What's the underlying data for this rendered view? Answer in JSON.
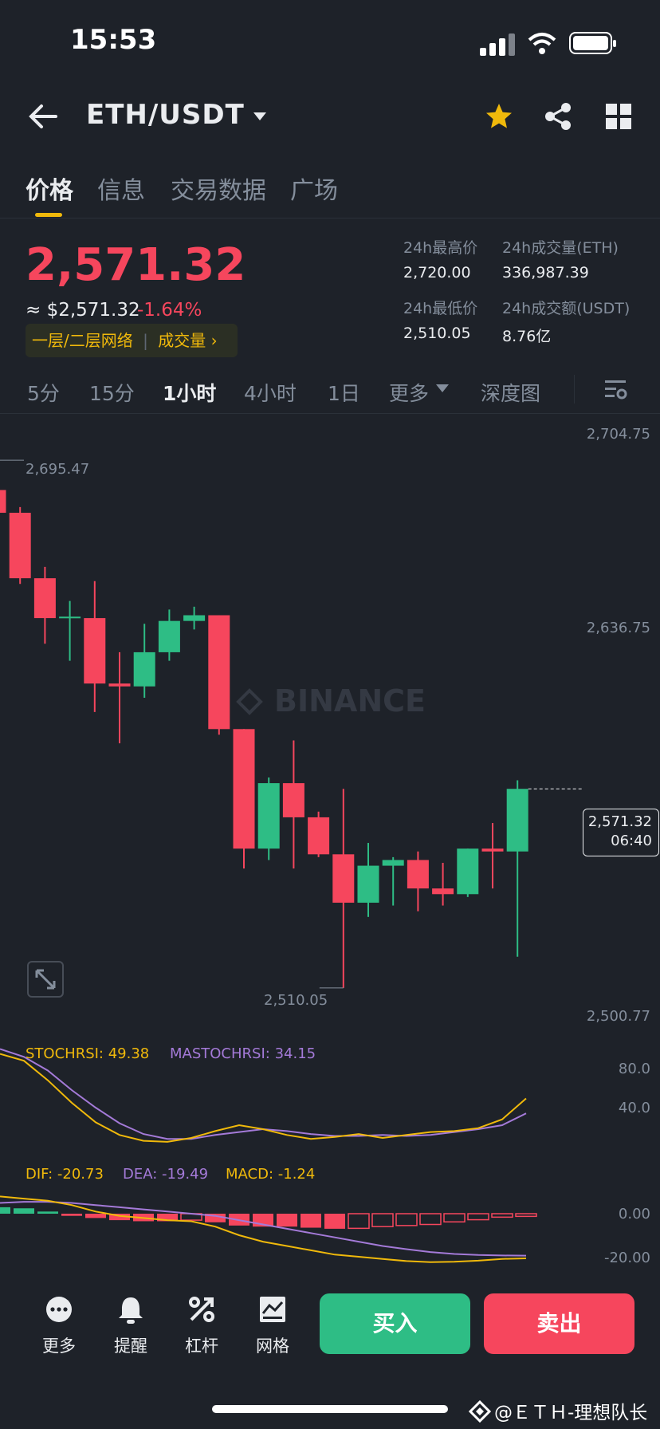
{
  "status_bar": {
    "time": "15:53"
  },
  "nav": {
    "pair": "ETH/USDT"
  },
  "tabs": [
    "价格",
    "信息",
    "交易数据",
    "广场"
  ],
  "price": {
    "last": "2,571.32",
    "usd": "≈ $2,571.32",
    "change": "-1.64%",
    "tag_network": "一层/二层网络",
    "tag_volume": "成交量 ›"
  },
  "stats": {
    "high_label": "24h最高价",
    "high_value": "2,720.00",
    "vol_label": "24h成交量(ETH)",
    "vol_value": "336,987.39",
    "low_label": "24h最低价",
    "low_value": "2,510.05",
    "amt_label": "24h成交额(USDT)",
    "amt_value": "8.76亿"
  },
  "timeframes": [
    "5分",
    "15分",
    "1小时",
    "4小时",
    "1日",
    "更多",
    "深度图"
  ],
  "timeframe_active": "1小时",
  "chart_data": {
    "type": "candlestick",
    "y_ticks": [
      "2,704.75",
      "2,636.75",
      "2,500.77"
    ],
    "high_marker": "2,695.47",
    "low_marker": "2,510.05",
    "last_price_tag": "2,571.32",
    "last_price_time": "06:40",
    "watermark": "BINANCE",
    "candles": [
      {
        "o": 2685,
        "h": 2695.47,
        "l": 2676,
        "c": 2677
      },
      {
        "o": 2677,
        "h": 2679,
        "l": 2652,
        "c": 2654
      },
      {
        "o": 2654,
        "h": 2658,
        "l": 2631,
        "c": 2640
      },
      {
        "o": 2640,
        "h": 2646,
        "l": 2625,
        "c": 2640.5
      },
      {
        "o": 2640,
        "h": 2653,
        "l": 2607,
        "c": 2617
      },
      {
        "o": 2617,
        "h": 2628,
        "l": 2596,
        "c": 2616
      },
      {
        "o": 2616,
        "h": 2638,
        "l": 2612,
        "c": 2628
      },
      {
        "o": 2628,
        "h": 2643,
        "l": 2625,
        "c": 2639
      },
      {
        "o": 2639,
        "h": 2644,
        "l": 2636,
        "c": 2641
      },
      {
        "o": 2641,
        "h": 2641,
        "l": 2599,
        "c": 2601
      },
      {
        "o": 2601,
        "h": 2601,
        "l": 2552,
        "c": 2559
      },
      {
        "o": 2559,
        "h": 2584,
        "l": 2555,
        "c": 2582
      },
      {
        "o": 2582,
        "h": 2597,
        "l": 2552,
        "c": 2570
      },
      {
        "o": 2570,
        "h": 2572,
        "l": 2556,
        "c": 2557
      },
      {
        "o": 2557,
        "h": 2580,
        "l": 2510.05,
        "c": 2540
      },
      {
        "o": 2540,
        "h": 2561,
        "l": 2535,
        "c": 2553
      },
      {
        "o": 2553,
        "h": 2556,
        "l": 2539,
        "c": 2555
      },
      {
        "o": 2555,
        "h": 2558,
        "l": 2537,
        "c": 2545
      },
      {
        "o": 2545,
        "h": 2554,
        "l": 2539,
        "c": 2543
      },
      {
        "o": 2543,
        "h": 2559,
        "l": 2542,
        "c": 2559
      },
      {
        "o": 2559,
        "h": 2568,
        "l": 2545,
        "c": 2558
      },
      {
        "o": 2558,
        "h": 2583,
        "l": 2521,
        "c": 2580
      }
    ],
    "stochrsi": {
      "label": "STOCHRSI: 49.38",
      "ma_label": "MASTOCHRSI: 34.15",
      "ticks": [
        "80.0",
        "40.0"
      ],
      "k": [
        95,
        88,
        68,
        45,
        25,
        12,
        6,
        5,
        9,
        16,
        22,
        18,
        12,
        8,
        10,
        13,
        9,
        12,
        15,
        16,
        19,
        28,
        49.38
      ],
      "d": [
        100,
        92,
        78,
        58,
        40,
        24,
        13,
        8,
        8,
        12,
        15,
        18,
        16,
        13,
        11,
        11,
        12,
        11,
        12,
        15,
        18,
        22,
        34.15
      ]
    },
    "macd": {
      "dif_label": "DIF: -20.73",
      "dea_label": "DEA: -19.49",
      "macd_label": "MACD: -1.24",
      "ticks": [
        "0.00",
        "-20.00"
      ],
      "dif": [
        8,
        7,
        6,
        4,
        1,
        -1,
        -2,
        -3,
        -3.5,
        -6,
        -10,
        -13,
        -15,
        -17,
        -19,
        -20,
        -21,
        -22,
        -22.5,
        -22.3,
        -21.8,
        -21,
        -20.73
      ],
      "dea": [
        5,
        5.5,
        5.5,
        5,
        4,
        3,
        2,
        1,
        0,
        -1,
        -3,
        -5,
        -7,
        -9,
        -11,
        -13,
        -15,
        -16.5,
        -17.8,
        -18.7,
        -19.2,
        -19.4,
        -19.49
      ],
      "hist": [
        3,
        2.5,
        1,
        -1,
        -2,
        -3,
        -3.5,
        -3.5,
        -3,
        -4,
        -5.5,
        -6,
        -6,
        -6.5,
        -7,
        -6.8,
        -6,
        -5.5,
        -5,
        -3.8,
        -2.8,
        -1.6,
        -1.24
      ]
    }
  },
  "toolbar": {
    "more": "更多",
    "alert": "提醒",
    "leverage": "杠杆",
    "grid": "网格",
    "buy": "买入",
    "sell": "卖出"
  },
  "footer": {
    "watermark": "@ＥＴＨ-理想队长"
  },
  "colors": {
    "up": "#2ebd85",
    "down": "#f6465d",
    "accent": "#f0b90b",
    "stoch_k": "#f0b90b",
    "stoch_d": "#a47ad8"
  }
}
